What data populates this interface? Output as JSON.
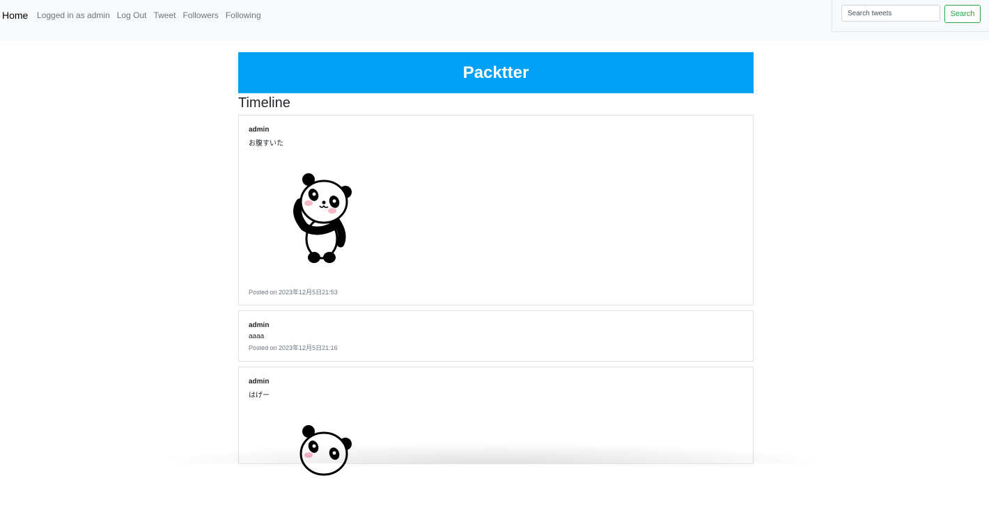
{
  "nav": {
    "brand": "Home",
    "links": [
      "Logged in as admin",
      "Log Out",
      "Tweet",
      "Followers",
      "Following"
    ],
    "search_placeholder": "Search tweets",
    "search_button": "Search"
  },
  "banner": {
    "title": "Packtter"
  },
  "timeline": {
    "title": "Timeline",
    "posts": [
      {
        "author": "admin",
        "text": "お腹すいた",
        "image": "panda-waving-icon",
        "date": "Posted on 2023年12月5日21:53"
      },
      {
        "author": "admin",
        "text": "aaaa",
        "image": "",
        "date": "Posted on 2023年12月5日21:16"
      },
      {
        "author": "admin",
        "text": "はげー",
        "image": "panda-waving-icon",
        "date": ""
      }
    ]
  },
  "colors": {
    "banner": "#00a0f6",
    "search_button": "#28a745",
    "navbar": "#f8f9fa"
  }
}
